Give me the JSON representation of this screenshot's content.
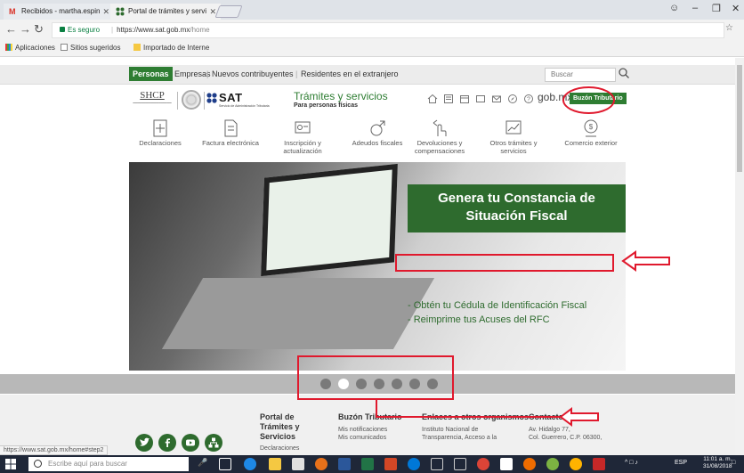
{
  "browser": {
    "tabs": [
      {
        "label": "Recibidos - martha.espin"
      },
      {
        "label": "Portal de trámites y servi"
      }
    ],
    "secure_label": "Es seguro",
    "url_host": "https://www.sat.gob.mx",
    "url_path": "/home",
    "bookmarks": [
      {
        "label": "Aplicaciones"
      },
      {
        "label": "Sitios sugeridos"
      },
      {
        "label": "Importado de Interne"
      }
    ]
  },
  "site": {
    "topnav": {
      "items": [
        "Personas",
        "Empresas",
        "Nuevos contribuyentes",
        "Residentes en el extranjero"
      ],
      "search_placeholder": "Buscar"
    },
    "brand": {
      "shcp": "SHCP",
      "sat": "SAT",
      "sat_sub": "Servicio de Administración Tributaria",
      "tramites": "Trámites y servicios",
      "tramites_sub": "Para personas físicas",
      "gobmx": "gob.mx",
      "buzon_button": "Buzón Tributario"
    },
    "categories": [
      {
        "label": "Declaraciones",
        "icon": "calculator-icon"
      },
      {
        "label": "Factura electrónica",
        "icon": "invoice-icon"
      },
      {
        "label": "Inscripción y actualización",
        "icon": "register-icon"
      },
      {
        "label": "Adeudos fiscales",
        "icon": "debt-icon"
      },
      {
        "label": "Devoluciones y compensaciones",
        "icon": "refund-icon"
      },
      {
        "label": "Otros trámites y servicios",
        "icon": "services-icon"
      },
      {
        "label": "Comercio exterior",
        "icon": "trade-icon"
      }
    ],
    "banner": {
      "title": "Genera tu Constancia de Situación Fiscal",
      "line1": "- Obtén tu Cédula de Identificación Fiscal",
      "line2": "- Reimprime tus Acuses del RFC"
    },
    "carousel": {
      "count": 7,
      "active": 1
    },
    "footer": {
      "col1_title": "Portal de Trámites y Servicios",
      "col1_links": [
        "Declaraciones"
      ],
      "col2_title": "Buzón Tributario",
      "col2_links": [
        "Mis notificaciones",
        "Mis comunicados"
      ],
      "col3_title": "Enlaces a otros organismos",
      "col3_links": [
        "Instituto Nacional de",
        "Transparencia, Acceso a la"
      ],
      "col4_title": "Contacto",
      "col4_links": [
        "Av. Hidalgo 77,",
        "Col. Guerrero, C.P. 06300,"
      ]
    },
    "status_url": "https://www.sat.gob.mx/home#step2"
  },
  "taskbar": {
    "search_placeholder": "Escribe aquí para buscar",
    "lang": "ESP",
    "time": "11:01 a. m.",
    "date": "31/08/2018"
  },
  "colors": {
    "sat_green": "#2e6b2e",
    "annotation_red": "#e0192d",
    "chrome_gray": "#f2f2f2"
  }
}
